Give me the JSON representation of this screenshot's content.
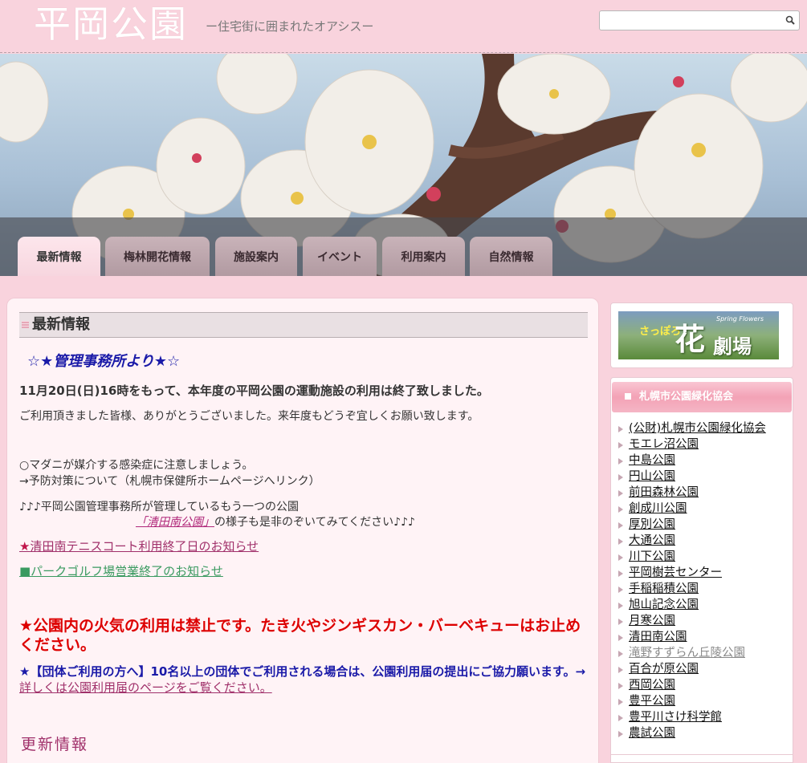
{
  "header": {
    "site_title": "平岡公園",
    "tagline": "ー住宅街に囲まれたオアシスー",
    "search": {
      "placeholder": ""
    }
  },
  "nav": {
    "tabs": [
      {
        "label": "最新情報",
        "active": true
      },
      {
        "label": "梅林開花情報",
        "active": false
      },
      {
        "label": "施設案内",
        "active": false
      },
      {
        "label": "イベント",
        "active": false
      },
      {
        "label": "利用案内",
        "active": false
      },
      {
        "label": "自然情報",
        "active": false
      }
    ]
  },
  "main": {
    "heading": "最新情報",
    "office_title": "☆★管理事務所より★☆",
    "notice_main": "11月20日(日)16時をもって、本年度の平岡公園の運動施設の利用は終了致しました。",
    "notice_thanks": "ご利用頂きました皆様、ありがとうございました。来年度もどうぞ宜しくお願い致します。",
    "tick_warning": "○マダニが媒介する感染症に注意しましょう。",
    "tick_link": "→予防対策について（札幌市保健所ホームページへリンク）",
    "other_park_line1": "♪♪♪平岡公園管理事務所が管理しているもう一つの公園",
    "other_park_link": "「清田南公園」",
    "other_park_line2_rest": "の様子も是非のぞいてみてください♪♪♪",
    "tennis_star": "★",
    "tennis_link": "清田南テニスコート利用終了日のお知らせ",
    "golf_link": "■パークゴルフ場営業終了のお知らせ",
    "fire_notice": "★公園内の火気の利用は禁止です。たき火やジンギスカン・バーベキューはお止めください。",
    "group_notice": "★【団体ご利用の方へ】10名以上の団体でご利用される場合は、公園利用届の提出にご協力願います。",
    "group_link_arrow": "→",
    "group_link": "詳しくは公園利用届のページをご覧ください。",
    "update_heading": "更新情報"
  },
  "sidebar": {
    "banner": {
      "sapporo": "さっぽろ",
      "spring": "Spring Flowers",
      "hana": "花",
      "gekijo": "劇場"
    },
    "links_heading": "札幌市公園緑化協会",
    "links": [
      {
        "label": "(公財)札幌市公園緑化協会",
        "visited": false
      },
      {
        "label": "モエレ沼公園",
        "visited": false
      },
      {
        "label": "中島公園",
        "visited": false
      },
      {
        "label": "円山公園",
        "visited": false
      },
      {
        "label": "前田森林公園",
        "visited": false
      },
      {
        "label": "創成川公園",
        "visited": false
      },
      {
        "label": "厚別公園",
        "visited": false
      },
      {
        "label": "大通公園",
        "visited": false
      },
      {
        "label": "川下公園",
        "visited": false
      },
      {
        "label": "平岡樹芸センター",
        "visited": false
      },
      {
        "label": "手稲稲積公園",
        "visited": false
      },
      {
        "label": "旭山記念公園",
        "visited": false
      },
      {
        "label": "月寒公園",
        "visited": false
      },
      {
        "label": "清田南公園",
        "visited": false
      },
      {
        "label": "滝野すずらん丘陵公園",
        "visited": true
      },
      {
        "label": "百合が原公園",
        "visited": false
      },
      {
        "label": "西岡公園",
        "visited": false
      },
      {
        "label": "豊平公園",
        "visited": false
      },
      {
        "label": "豊平川さけ科学館",
        "visited": false
      },
      {
        "label": "農試公園",
        "visited": false
      }
    ]
  },
  "colors": {
    "page_bg": "#f9d3dd",
    "accent_blue": "#1a1aa8",
    "alert_red": "#dd0000",
    "link_pink": "#a0306a",
    "link_green": "#3a9a60"
  }
}
